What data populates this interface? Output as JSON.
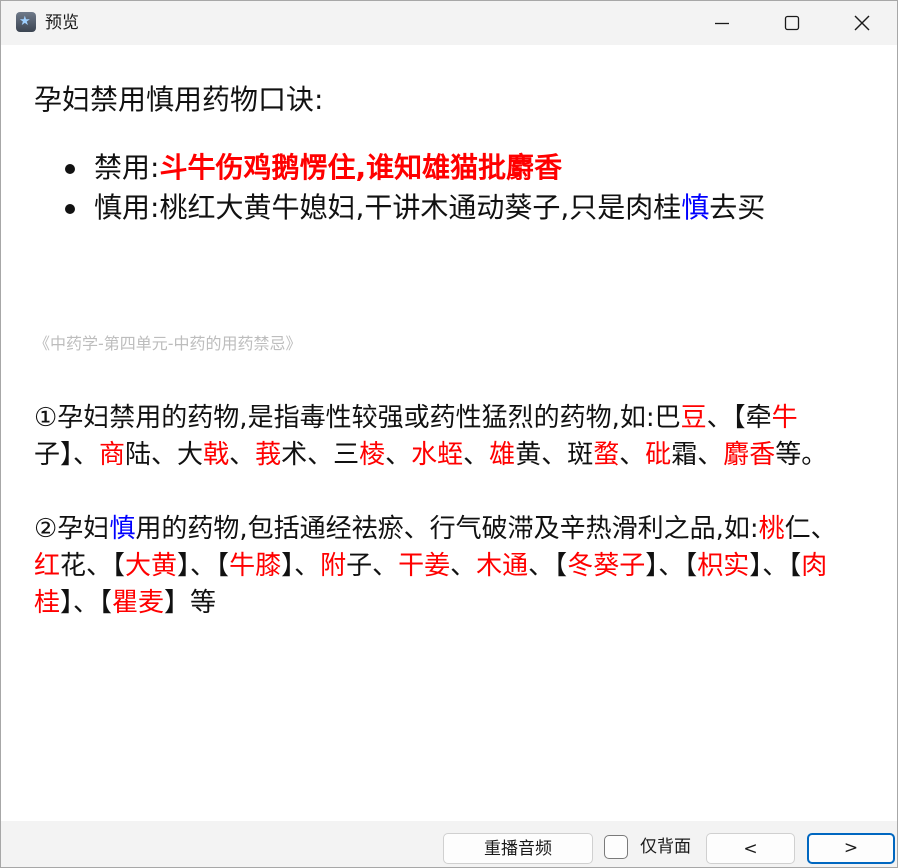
{
  "window": {
    "title": "预览"
  },
  "content": {
    "heading": "孕妇禁用慎用药物口诀:",
    "bullets": {
      "forbidden": {
        "label": "禁用:",
        "text": "斗牛伤鸡鹅愣住,谁知雄猫批麝香"
      },
      "caution": {
        "label": "慎用:",
        "text_before": "桃红大黄牛媳妇,干讲木通动葵子,只是肉桂",
        "highlight": "慎",
        "text_after": "去买"
      }
    },
    "source": "《中药学-第四单元-中药的用药禁忌》",
    "para1": [
      {
        "t": "①孕妇禁用的药物,是指毒性较强或药性猛烈的药物,如:巴",
        "c": ""
      },
      {
        "t": "豆",
        "c": "red"
      },
      {
        "t": "、【牵",
        "c": ""
      },
      {
        "t": "牛",
        "c": "red"
      },
      {
        "t": "子】、",
        "c": ""
      },
      {
        "t": "商",
        "c": "red"
      },
      {
        "t": "陆、大",
        "c": ""
      },
      {
        "t": "戟",
        "c": "red"
      },
      {
        "t": "、",
        "c": ""
      },
      {
        "t": "莪",
        "c": "red"
      },
      {
        "t": "术、三",
        "c": ""
      },
      {
        "t": "棱",
        "c": "red"
      },
      {
        "t": "、",
        "c": ""
      },
      {
        "t": "水蛭",
        "c": "red"
      },
      {
        "t": "、",
        "c": ""
      },
      {
        "t": "雄",
        "c": "red"
      },
      {
        "t": "黄、斑",
        "c": ""
      },
      {
        "t": "蝥",
        "c": "red"
      },
      {
        "t": "、",
        "c": ""
      },
      {
        "t": "砒",
        "c": "red"
      },
      {
        "t": "霜、",
        "c": ""
      },
      {
        "t": "麝香",
        "c": "red"
      },
      {
        "t": "等。",
        "c": ""
      }
    ],
    "para2": [
      {
        "t": "②孕妇",
        "c": ""
      },
      {
        "t": "慎",
        "c": "blue"
      },
      {
        "t": "用的药物,包括通经祛瘀、行气破滞及辛热滑利之品,如:",
        "c": ""
      },
      {
        "t": "桃",
        "c": "red"
      },
      {
        "t": "仁、",
        "c": ""
      },
      {
        "t": "红",
        "c": "red"
      },
      {
        "t": "花、【",
        "c": ""
      },
      {
        "t": "大黄",
        "c": "red"
      },
      {
        "t": "】、【",
        "c": ""
      },
      {
        "t": "牛膝",
        "c": "red"
      },
      {
        "t": "】、",
        "c": ""
      },
      {
        "t": "附",
        "c": "red"
      },
      {
        "t": "子、",
        "c": ""
      },
      {
        "t": "干姜",
        "c": "red"
      },
      {
        "t": "、",
        "c": ""
      },
      {
        "t": "木通",
        "c": "red"
      },
      {
        "t": "、【",
        "c": ""
      },
      {
        "t": "冬葵子",
        "c": "red"
      },
      {
        "t": "】、【",
        "c": ""
      },
      {
        "t": "枳实",
        "c": "red"
      },
      {
        "t": "】、【",
        "c": ""
      },
      {
        "t": "肉桂",
        "c": "red"
      },
      {
        "t": "】、【",
        "c": ""
      },
      {
        "t": "瞿麦",
        "c": "red"
      },
      {
        "t": "】等",
        "c": ""
      }
    ]
  },
  "footer": {
    "replay_label": "重播音频",
    "back_only_label": "仅背面",
    "back_only_checked": false,
    "prev_label": "<",
    "next_label": ">"
  },
  "colors": {
    "highlight_red": "#ff0000",
    "highlight_blue": "#0000ff",
    "accent": "#0067c0"
  },
  "icons": {
    "app": "app-star-icon",
    "minimize": "minimize-icon",
    "maximize": "maximize-icon",
    "close": "close-icon"
  }
}
